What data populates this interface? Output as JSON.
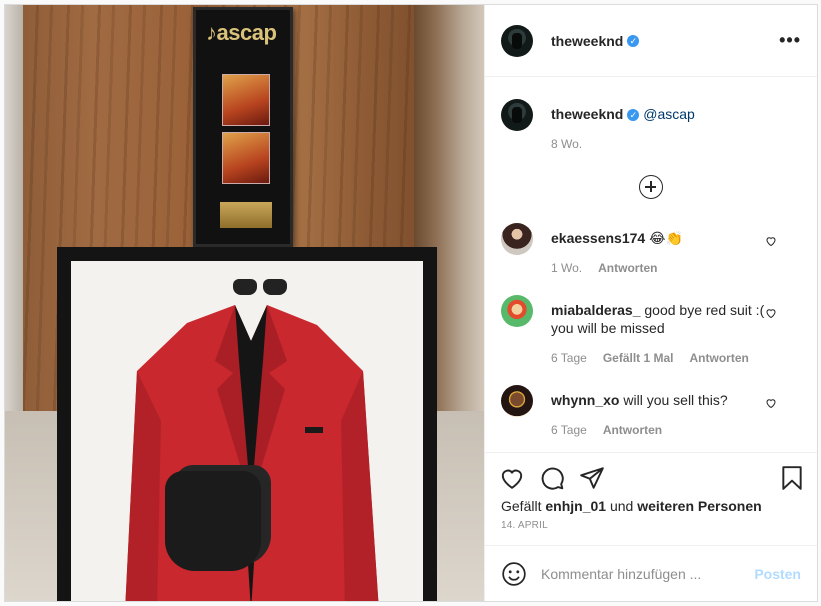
{
  "post": {
    "author": "theweeknd",
    "menu_icon": "more-options-icon",
    "caption": {
      "username": "theweeknd",
      "mention": "@ascap",
      "time": "8 Wo."
    },
    "photo": {
      "plaque_logo": "♪ascap"
    }
  },
  "comments": [
    {
      "username": "ekaessens174",
      "text": "😂👏",
      "time": "1 Wo.",
      "reply": "Antworten",
      "likes": ""
    },
    {
      "username": "miabalderas_",
      "text": "good bye red suit :( you will be missed",
      "time": "6 Tage",
      "likes": "Gefällt 1 Mal",
      "reply": "Antworten"
    },
    {
      "username": "whynn_xo",
      "text": "will you sell this?",
      "time": "6 Tage",
      "reply": "Antworten",
      "likes": ""
    }
  ],
  "actions": {
    "like": "heart-icon",
    "comment": "comment-icon",
    "share": "share-icon",
    "save": "bookmark-icon"
  },
  "likes": {
    "prefix": "Gefällt",
    "user": "enhjn_01",
    "middle": "und",
    "others": "weiteren Personen"
  },
  "date": "14. APRIL",
  "add_comment": {
    "placeholder": "Kommentar hinzufügen ...",
    "post_label": "Posten"
  },
  "colors": {
    "verified": "#3897f0",
    "post_button_disabled": "#b3dbff",
    "jacket_red": "#c8282e"
  }
}
